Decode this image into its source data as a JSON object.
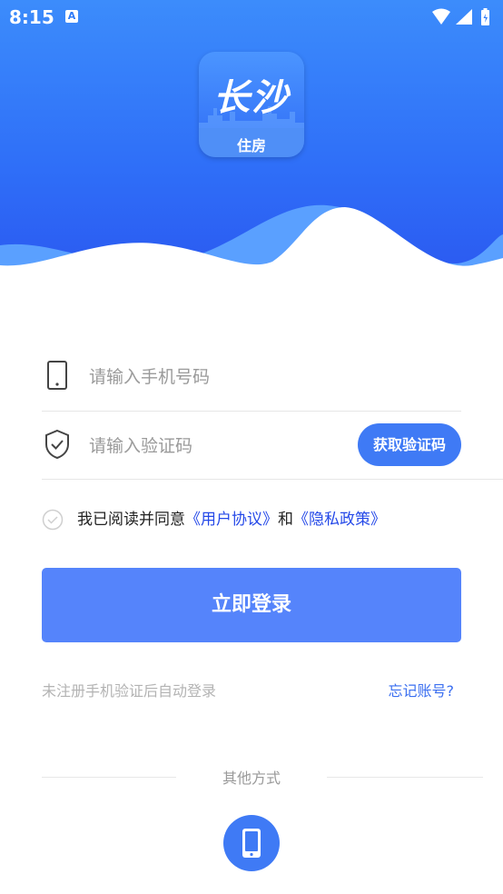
{
  "status_bar": {
    "time": "8:15",
    "notification_icon": "A"
  },
  "logo": {
    "title": "长沙",
    "subtitle": "住房"
  },
  "form": {
    "phone_placeholder": "请输入手机号码",
    "code_placeholder": "请输入验证码",
    "get_code_label": "获取验证码"
  },
  "agreement": {
    "prefix": "我已阅读并同意",
    "user_agreement": "《用户协议》",
    "conjunction": "和",
    "privacy_policy": "《隐私政策》"
  },
  "login": {
    "button_label": "立即登录",
    "hint": "未注册手机验证后自动登录",
    "forgot_label": "忘记账号?"
  },
  "other": {
    "label": "其他方式",
    "method_icon": "phone-icon"
  },
  "colors": {
    "brand_blue": "#3f7af5",
    "login_button": "#5584fb",
    "link_blue": "#2549e8"
  }
}
